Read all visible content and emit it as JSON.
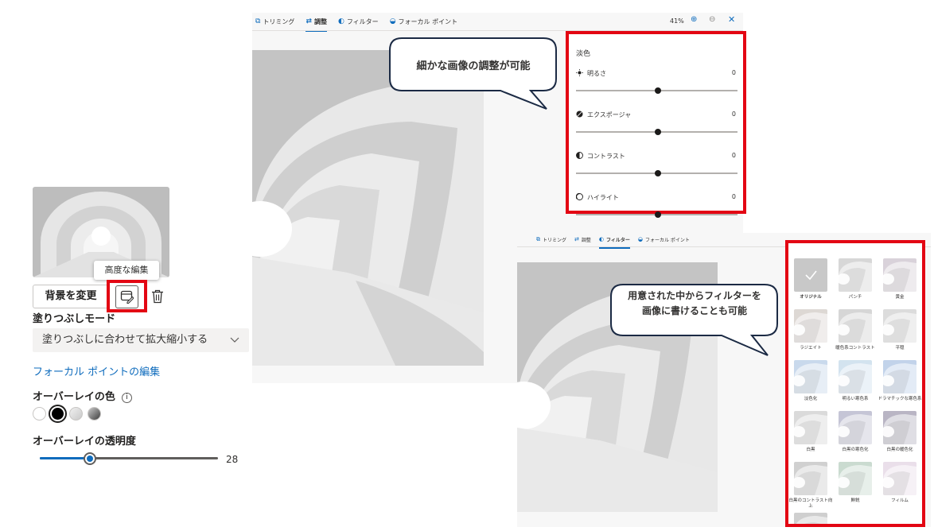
{
  "left_panel": {
    "tooltip": "高度な編集",
    "change_background_button": "背景を変更",
    "fill_mode_label": "塗りつぶしモード",
    "fill_mode_value": "塗りつぶしに合わせて拡大縮小する",
    "focal_point_link": "フォーカル ポイントの編集",
    "overlay_color_label": "オーバーレイの色",
    "overlay_color_info": "i",
    "overlay_colors": [
      "#ffffff",
      "#000000",
      "#dcdcdc",
      "#6b6b6b"
    ],
    "overlay_transparency_label": "オーバーレイの透明度",
    "overlay_transparency_value": "28",
    "overlay_transparency_fraction": 0.28
  },
  "adjust_window": {
    "tabs": [
      {
        "label": "トリミング",
        "icon": "crop-icon"
      },
      {
        "label": "調整",
        "icon": "adjust-icon",
        "active": true
      },
      {
        "label": "フィルター",
        "icon": "filter-icon"
      },
      {
        "label": "フォーカル ポイント",
        "icon": "focal-point-icon"
      }
    ],
    "zoom": "41%",
    "panel_title": "淡色",
    "adjustments": [
      {
        "label": "明るさ",
        "value": "0",
        "icon": "brightness-icon"
      },
      {
        "label": "エクスポージャ",
        "value": "0",
        "icon": "exposure-icon"
      },
      {
        "label": "コントラスト",
        "value": "0",
        "icon": "contrast-icon"
      },
      {
        "label": "ハイライト",
        "value": "0",
        "icon": "highlight-icon"
      }
    ],
    "callout": "細かな画像の調整が可能"
  },
  "filter_window": {
    "tabs": [
      {
        "label": "トリミング",
        "icon": "crop-icon"
      },
      {
        "label": "調整",
        "icon": "adjust-icon"
      },
      {
        "label": "フィルター",
        "icon": "filter-icon",
        "active": true
      },
      {
        "label": "フォーカル ポイント",
        "icon": "focal-point-icon"
      }
    ],
    "callout_line1": "用意された中からフィルターを",
    "callout_line2": "画像に書けることも可能",
    "filters": [
      {
        "label": "オリジナル",
        "tint": "#c8c8c8",
        "selected": true
      },
      {
        "label": "パンチ",
        "tint": "#d7d7d7"
      },
      {
        "label": "黄金",
        "tint": "#d9d2da"
      },
      {
        "label": "ラジエイト",
        "tint": "#ddd8d4"
      },
      {
        "label": "暖色系コントラスト",
        "tint": "#d6d6d6"
      },
      {
        "label": "平穏",
        "tint": "#dcdcdc"
      },
      {
        "label": "淡色化",
        "tint": "#c9d9ec"
      },
      {
        "label": "明るい寒色系",
        "tint": "#d3e3ef"
      },
      {
        "label": "ドラマチックな寒色系",
        "tint": "#c2d3ea"
      },
      {
        "label": "白黒",
        "tint": "#dadada"
      },
      {
        "label": "白黒の寒色化",
        "tint": "#c5c5d6"
      },
      {
        "label": "白黒の暖色化",
        "tint": "#b9b5c4"
      },
      {
        "label": "白黒のコントラスト向上",
        "tint": "#d0d0d0"
      },
      {
        "label": "鮮鋭",
        "tint": "#cadbd0"
      },
      {
        "label": "フィルム",
        "tint": "#eadfea"
      },
      {
        "label": "",
        "tint": "#cfcfcf"
      }
    ]
  }
}
